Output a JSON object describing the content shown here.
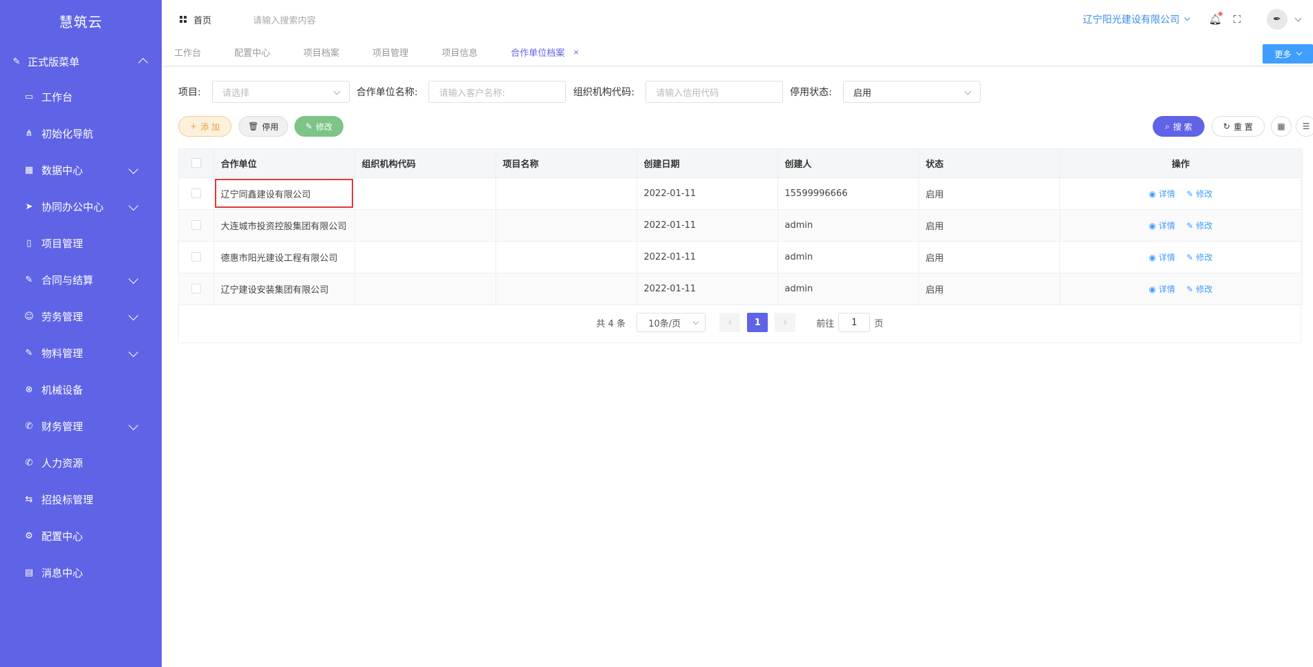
{
  "app": {
    "brand": "慧筑云"
  },
  "sidebar": {
    "group": {
      "label": "正式版菜单",
      "icon": "edit-doc-icon"
    },
    "items": [
      {
        "label": "工作台",
        "icon": "monitor-icon",
        "expandable": false
      },
      {
        "label": "初始化导航",
        "icon": "sitemap-icon",
        "expandable": false
      },
      {
        "label": "数据中心",
        "icon": "grid-icon",
        "expandable": true
      },
      {
        "label": "协同办公中心",
        "icon": "send-icon",
        "expandable": true
      },
      {
        "label": "项目管理",
        "icon": "book-icon",
        "expandable": false
      },
      {
        "label": "合同与结算",
        "icon": "contract-icon",
        "expandable": true
      },
      {
        "label": "劳务管理",
        "icon": "users-icon",
        "expandable": true
      },
      {
        "label": "物料管理",
        "icon": "edit-doc-icon",
        "expandable": true
      },
      {
        "label": "机械设备",
        "icon": "circle-x-icon",
        "expandable": false
      },
      {
        "label": "财务管理",
        "icon": "phone-icon",
        "expandable": true
      },
      {
        "label": "人力资源",
        "icon": "phone-icon",
        "expandable": false
      },
      {
        "label": "招投标管理",
        "icon": "swap-icon",
        "expandable": false
      },
      {
        "label": "配置中心",
        "icon": "gear-icon",
        "expandable": false
      },
      {
        "label": "消息中心",
        "icon": "message-icon",
        "expandable": false
      }
    ]
  },
  "header": {
    "home": "首页",
    "search_placeholder": "请输入搜索内容",
    "company": "辽宁阳光建设有限公司"
  },
  "tabs": {
    "items": [
      "工作台",
      "配置中心",
      "项目档案",
      "项目管理",
      "项目信息"
    ],
    "active": "合作单位档案",
    "close": "×",
    "more": "更多"
  },
  "filters": {
    "project_label": "项目:",
    "project_placeholder": "请选择",
    "unit_label": "合作单位名称:",
    "unit_placeholder": "请输入客户名称:",
    "org_label": "组织机构代码:",
    "org_placeholder": "请输入信用代码",
    "status_label": "停用状态:",
    "status_value": "启用"
  },
  "toolbar": {
    "add": "添 加",
    "disable": "停用",
    "edit": "修改",
    "search": "搜 索",
    "reset": "重 置"
  },
  "table": {
    "columns": [
      "合作单位",
      "组织机构代码",
      "项目名称",
      "创建日期",
      "创建人",
      "状态",
      "操作"
    ],
    "rows": [
      {
        "unit": "辽宁同鑫建设有限公司",
        "org": "",
        "project": "",
        "date": "2022-01-11",
        "creator": "15599996666",
        "status": "启用"
      },
      {
        "unit": "大连城市投资控股集团有限公司",
        "org": "",
        "project": "",
        "date": "2022-01-11",
        "creator": "admin",
        "status": "启用"
      },
      {
        "unit": "德惠市阳光建设工程有限公司",
        "org": "",
        "project": "",
        "date": "2022-01-11",
        "creator": "admin",
        "status": "启用"
      },
      {
        "unit": "辽宁建设安装集团有限公司",
        "org": "",
        "project": "",
        "date": "2022-01-11",
        "creator": "admin",
        "status": "启用"
      }
    ],
    "op_detail": "详情",
    "op_edit": "修改"
  },
  "pager": {
    "total": "共 4 条",
    "size": "10条/页",
    "current": "1",
    "goto": "前往",
    "goto_value": "1",
    "page_unit": "页"
  },
  "colors": {
    "sidebar": "#5f63e6",
    "accent": "#409eff",
    "highlight": "#e03636"
  }
}
